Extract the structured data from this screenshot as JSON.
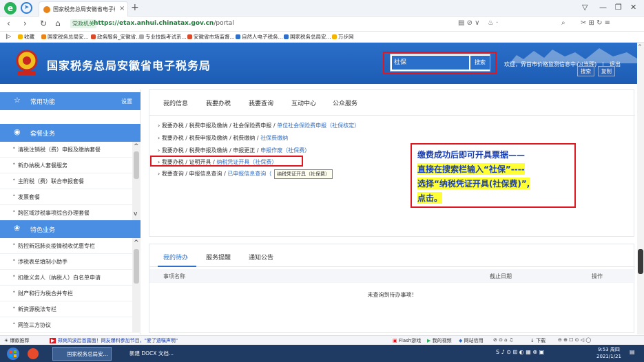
{
  "browser": {
    "tab_title": "国家税务总局安徽省电子税务局",
    "address": {
      "badge": "党政机关",
      "url_host": "https://etax.anhui.chinatax.gov.cn",
      "url_path": "/portal"
    },
    "bookmarks": [
      "收藏",
      "国家税务总局安...",
      "政务服务_安徽省...",
      "专业技能考试系...",
      "安徽省市场监督...",
      "自然人电子税务...",
      "国家税务总局安...",
      "万步网"
    ]
  },
  "site": {
    "title": "国家税务总局安徽省电子税务局",
    "search_value": "社保",
    "search_button": "搜索",
    "welcome": "欢迎，界首市价格监测信息中心(当理)",
    "logout": "退出",
    "btn_search": "搜索",
    "btn_copy": "复制"
  },
  "sidebar": {
    "common": {
      "label": "常用功能",
      "settings": "设置"
    },
    "package": {
      "label": "套餐业务",
      "items": [
        "清税注销税（费）申报及缴纳套餐",
        "新办纳税人套餐服务",
        "主附税（费）联合申报套餐",
        "发票套餐",
        "跨区域涉税事项综合办理套餐"
      ]
    },
    "special": {
      "label": "特色业务",
      "items": [
        "防控新冠肺炎疫情税收优惠专栏",
        "涉税表单填制小助手",
        "扣缴义务人（纳税人）白名单申请",
        "财产和行为税合并专栏",
        "新资源税法专栏",
        "网签三方协议"
      ]
    }
  },
  "main": {
    "tabs": [
      "我的信息",
      "我要办税",
      "我要查询",
      "互动中心",
      "公众服务"
    ],
    "results": [
      {
        "path": "我要办税 / 税费申报及缴纳 / 社会保险费申报 / ",
        "link": "单位社会保险费申报（社保核定）"
      },
      {
        "path": "我要办税 / 税费申报及缴纳 / 税费缴纳 / ",
        "link": "社保费缴纳"
      },
      {
        "path": "我要办税 / 税费申报及缴纳 / 申报更正 / ",
        "link": "申报作废（社保费）"
      },
      {
        "path": "我要办税 / 证明开具 / ",
        "link": "纳税凭证开具（社保费）"
      },
      {
        "path": "我要查询 / 申报信息查询 / ",
        "link": "已申报信息查询（"
      }
    ],
    "tooltip": "纳税凭证开具（社保费）"
  },
  "note": {
    "line1": "缴费成功后即可开具票据——",
    "line2": "直接在搜索栏输入“社保”----",
    "line3": "选择“纳税凭证开具(社保费)”,",
    "line4": "点击。"
  },
  "lower": {
    "tabs": [
      "我的待办",
      "服务提醒",
      "通知公告"
    ],
    "col_name": "事项名称",
    "col_deadline": "截止日期",
    "col_action": "操作",
    "empty": "未查询到待办事项！"
  },
  "statusbar": {
    "left1": "爆款推荐",
    "news": "郑爽风波后首露面！网友爆料参加节目，\"爱了遗嘱声明\"",
    "right_items": [
      "Flash游戏",
      "我的视频",
      "网站信用",
      "下载"
    ]
  },
  "taskbar": {
    "apps": [
      "国家税务总局安...",
      "新建 DOCX 文档..."
    ],
    "time": "9:53 周四",
    "date": "2021/1/21"
  },
  "colors": {
    "header_blue": "#1d5cb4",
    "accent_red": "#e0171e",
    "link_blue": "#2f6fc9",
    "highlight_yellow": "#ffff33"
  }
}
